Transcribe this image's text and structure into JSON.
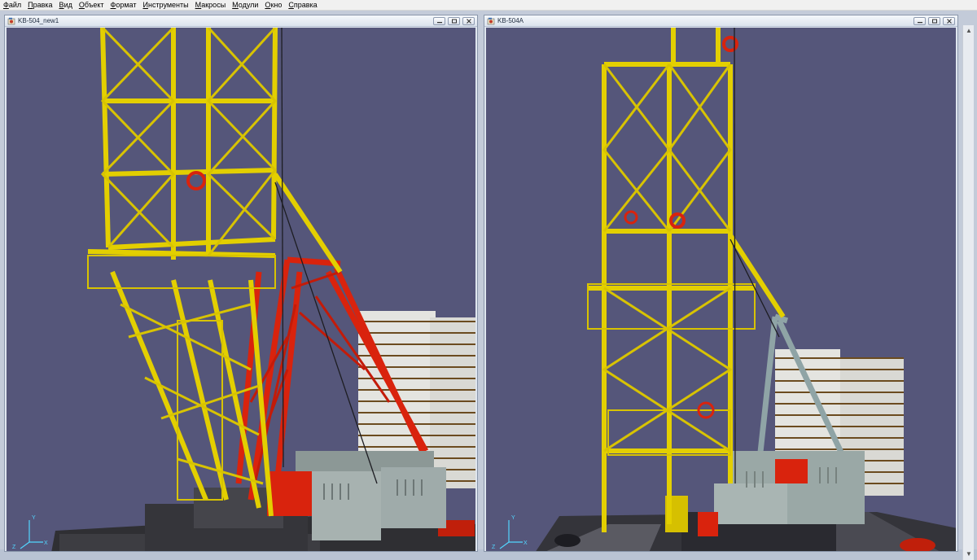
{
  "menu": {
    "items": [
      "Файл",
      "Правка",
      "Вид",
      "Объект",
      "Формат",
      "Инструменты",
      "Макросы",
      "Модули",
      "Окно",
      "Справка"
    ]
  },
  "windows": [
    {
      "title": "KB-504_new1"
    },
    {
      "title": "KB-504A"
    }
  ],
  "axes": {
    "x": "X",
    "y": "Y",
    "z": "Z"
  },
  "window_controls": {
    "minimize": "minimize-icon",
    "restore": "restore-icon",
    "close": "close-icon"
  },
  "colors": {
    "viewport_bg": "#55567a",
    "tower_yellow": "#e3cf00",
    "boom_red": "#d9230d",
    "boom_grey": "#8fa4a6",
    "counterweight": "#e4e4e0",
    "counterweight_stripe": "#6b4b1f",
    "cabin_grey": "#9aa8a6",
    "base_dark": "#3a3a3e"
  }
}
